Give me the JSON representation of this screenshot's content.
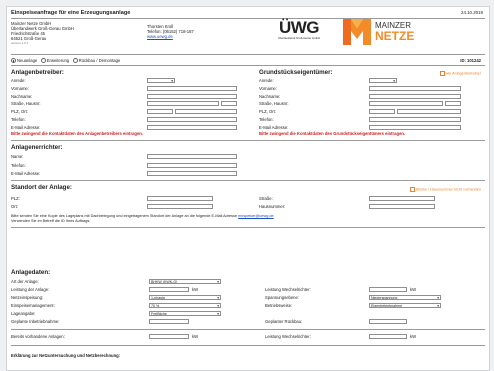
{
  "header": {
    "title": "Einspeiseanfrage für eine Erzeugungsanlage",
    "date": "24.10.2019",
    "company_lines": [
      "Mainzer Netze GmbH",
      "Überlandwerk Groß-Gerau GmbH",
      "Friedrichstraße 45",
      "64521 Groß-Gerau",
      "version 1.0.1"
    ],
    "contact_name": "Thorsten Kroll",
    "contact_phone": "Telefon: (06152) 718-187",
    "contact_web": "www.uewg.de",
    "uewg_logo": "ÜWG",
    "uewg_sub": "Überlandwerk Groß-Gerau GmbH",
    "mn_logo_line1": "MAINZER",
    "mn_logo_line2": "NETZE",
    "id_label": "ID: 101242"
  },
  "type_options": [
    {
      "label": "Neuanlage",
      "selected": true
    },
    {
      "label": "Erweiterung",
      "selected": false
    },
    {
      "label": "Rückbau / Demontage",
      "selected": false
    }
  ],
  "betreiber": {
    "title": "Anlagenbetreiber:",
    "fields": [
      "Anrede:",
      "Vorname:",
      "Nachname:",
      "Straße, Hausnr:",
      "PLZ, Ort:",
      "Telefon:",
      "E-Mail Adresse:"
    ],
    "warning": "Bitte zwingend die Kontaktdaten des Anlagenbetreibers eintragen."
  },
  "eigentuemer": {
    "title": "Grundstückseigentümer:",
    "checkbox": "wie Anlagenbetreiber",
    "fields": [
      "Anrede:",
      "Vorname:",
      "Nachname:",
      "Straße, Hausnr:",
      "PLZ, Ort:",
      "Telefon:",
      "E-Mail Adresse:"
    ],
    "warning": "Bitte zwingend die Kontaktdaten des Grundstückseigentümers eintragen."
  },
  "errichter": {
    "title": "Anlagenerrichter:",
    "fields": [
      "Name:",
      "Telefon:",
      "E-Mail Adresse:"
    ]
  },
  "standort": {
    "title": "Standort der Anlage:",
    "checkbox": "Straße / Hausnummer nicht vorhanden",
    "plz": "PLZ:",
    "ort": "Ort:",
    "strasse": "Straße:",
    "hausnr": "Hausnummer:",
    "note1_pre": "Bitte senden Sie eine Kopie des Lageplans mit Dachbelegung und eingetragenem Standort der Anlage an die folgende E-Mail Adresse ",
    "note1_email": "einspeiser@uewg.de",
    "note2": "Verwenden Sie im Betreff die ID Ihres Auftrags."
  },
  "anlagedaten": {
    "title": "Anlagedaten:",
    "art_label": "Art der Anlage:",
    "art_value": "BHKW (KWK-G)",
    "leistung_label": "Leistung der Anlage:",
    "kw": "kW",
    "netz_label": "Netzeinspeisung:",
    "netz_value": "1-phasig",
    "einspeise_label": "Einspeisemanagement:",
    "einspeise_value": "70 %",
    "lage_label": "Lageangabe:",
    "lage_value": "Freifläche",
    "geplant_ib_label": "Geplante Inbetriebnahme:",
    "wr_label": "Leistung Wechselrichter:",
    "spannung_label": "Spannungsebene:",
    "spannung_value": "Niederspannung",
    "betrieb_label": "Betriebsweise:",
    "betrieb_value": "Eigenbetriebnahme",
    "rueckbau_label": "Geplanter Rückbau:",
    "bestehend_label": "Bereits vorhandene Anlagen:",
    "wr2_label": "Leistung Wechselrichter:"
  },
  "footer": {
    "title": "Erklärung zur Netzuntersuchung und Netzberechnung:"
  },
  "colors": {
    "accent_red": "#cc1f1f",
    "accent_orange": "#e8822c",
    "link_blue": "#1a4fbf"
  }
}
